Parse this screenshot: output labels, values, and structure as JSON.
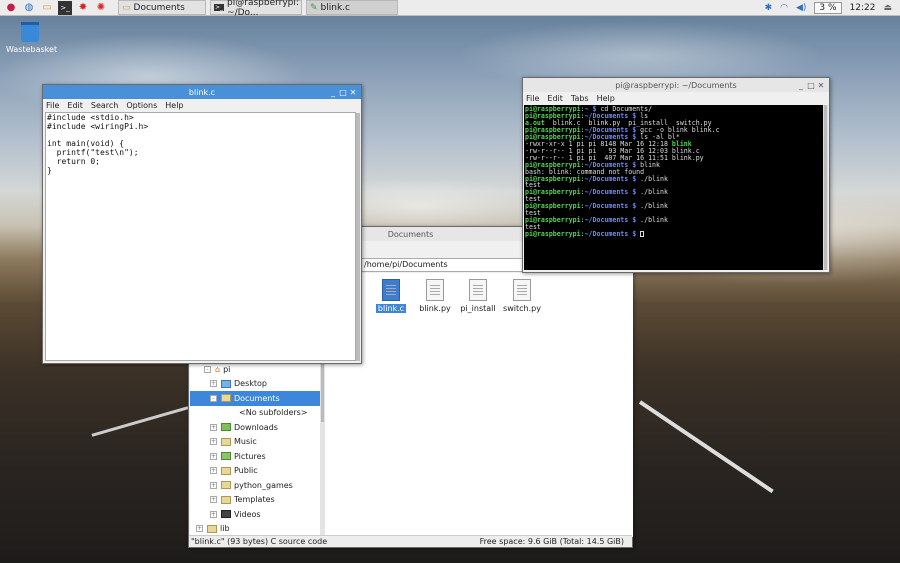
{
  "taskbar": {
    "launchers": [
      "raspberry-menu-icon",
      "web-browser-icon",
      "file-manager-icon",
      "terminal-icon",
      "math-icon",
      "wolfram-icon"
    ],
    "buttons": [
      {
        "label": "Documents",
        "icon": "folder-icon"
      },
      {
        "label": "pi@raspberrypi: ~/Do...",
        "icon": "terminal-icon"
      },
      {
        "label": "blink.c",
        "icon": "text-editor-icon"
      }
    ],
    "cpu": "3 %",
    "clock": "12:22"
  },
  "desktop": {
    "wastebasket_label": "Wastebasket"
  },
  "editor": {
    "title": "blink.c",
    "menu": [
      "File",
      "Edit",
      "Search",
      "Options",
      "Help"
    ],
    "content": "#include <stdio.h>\n#include <wiringPi.h>\n\nint main(void) {\n  printf(\"test\\n\");\n  return 0;\n}"
  },
  "file_manager": {
    "title": "Documents",
    "path": "/home/pi/Documents",
    "files": [
      {
        "name": "blink.c",
        "selected": true
      },
      {
        "name": "blink.py",
        "selected": false
      },
      {
        "name": "pi_install",
        "selected": false
      },
      {
        "name": "switch.py",
        "selected": false
      }
    ],
    "tree": [
      {
        "label": "pi",
        "indent": 1,
        "exp": "-",
        "selected": false
      },
      {
        "label": "Desktop",
        "indent": 2,
        "exp": "+",
        "selected": false
      },
      {
        "label": "Documents",
        "indent": 2,
        "exp": "-",
        "selected": true
      },
      {
        "label": "<No subfolders>",
        "indent": 3,
        "exp": "",
        "selected": false
      },
      {
        "label": "Downloads",
        "indent": 2,
        "exp": "+",
        "selected": false
      },
      {
        "label": "Music",
        "indent": 2,
        "exp": "+",
        "selected": false
      },
      {
        "label": "Pictures",
        "indent": 2,
        "exp": "+",
        "selected": false
      },
      {
        "label": "Public",
        "indent": 2,
        "exp": "+",
        "selected": false
      },
      {
        "label": "python_games",
        "indent": 2,
        "exp": "+",
        "selected": false
      },
      {
        "label": "Templates",
        "indent": 2,
        "exp": "+",
        "selected": false
      },
      {
        "label": "Videos",
        "indent": 2,
        "exp": "+",
        "selected": false
      },
      {
        "label": "lib",
        "indent": 1,
        "exp": "+",
        "selected": false
      }
    ],
    "status_left": "\"blink.c\" (93 bytes) C source code",
    "status_right": "Free space: 9.6 GiB (Total: 14.5 GiB)"
  },
  "terminal": {
    "title": "pi@raspberrypi: ~/Documents",
    "menu": [
      "File",
      "Edit",
      "Tabs",
      "Help"
    ],
    "lines": [
      [
        {
          "t": "pi@raspberrypi",
          "c": "g"
        },
        {
          "t": ":",
          "c": ""
        },
        {
          "t": "~ $",
          "c": "b"
        },
        {
          "t": " cd Documents/",
          "c": ""
        }
      ],
      [
        {
          "t": "pi@raspberrypi",
          "c": "g"
        },
        {
          "t": ":",
          "c": ""
        },
        {
          "t": "~/Documents $",
          "c": "b"
        },
        {
          "t": " ls",
          "c": ""
        }
      ],
      [
        {
          "t": "a.out",
          "c": "g"
        },
        {
          "t": "  blink.c  blink.py  pi_install  switch.py",
          "c": ""
        }
      ],
      [
        {
          "t": "pi@raspberrypi",
          "c": "g"
        },
        {
          "t": ":",
          "c": ""
        },
        {
          "t": "~/Documents $",
          "c": "b"
        },
        {
          "t": " gcc -o blink blink.c",
          "c": ""
        }
      ],
      [
        {
          "t": "pi@raspberrypi",
          "c": "g"
        },
        {
          "t": ":",
          "c": ""
        },
        {
          "t": "~/Documents $",
          "c": "b"
        },
        {
          "t": " ls -al bl*",
          "c": ""
        }
      ],
      [
        {
          "t": "-rwxr-xr-x 1 pi pi 8148 Mar 16 12:18 ",
          "c": ""
        },
        {
          "t": "blink",
          "c": "g"
        }
      ],
      [
        {
          "t": "-rw-r--r-- 1 pi pi   93 Mar 16 12:03 blink.c",
          "c": ""
        }
      ],
      [
        {
          "t": "-rw-r--r-- 1 pi pi  407 Mar 16 11:51 blink.py",
          "c": ""
        }
      ],
      [
        {
          "t": "pi@raspberrypi",
          "c": "g"
        },
        {
          "t": ":",
          "c": ""
        },
        {
          "t": "~/Documents $",
          "c": "b"
        },
        {
          "t": " blink",
          "c": ""
        }
      ],
      [
        {
          "t": "bash: blink: command not found",
          "c": ""
        }
      ],
      [
        {
          "t": "pi@raspberrypi",
          "c": "g"
        },
        {
          "t": ":",
          "c": ""
        },
        {
          "t": "~/Documents $",
          "c": "b"
        },
        {
          "t": " ./blink",
          "c": ""
        }
      ],
      [
        {
          "t": "test",
          "c": ""
        }
      ],
      [
        {
          "t": "pi@raspberrypi",
          "c": "g"
        },
        {
          "t": ":",
          "c": ""
        },
        {
          "t": "~/Documents $",
          "c": "b"
        },
        {
          "t": " ./blink",
          "c": ""
        }
      ],
      [
        {
          "t": "test",
          "c": ""
        }
      ],
      [
        {
          "t": "pi@raspberrypi",
          "c": "g"
        },
        {
          "t": ":",
          "c": ""
        },
        {
          "t": "~/Documents $",
          "c": "b"
        },
        {
          "t": " ./blink",
          "c": ""
        }
      ],
      [
        {
          "t": "test",
          "c": ""
        }
      ],
      [
        {
          "t": "pi@raspberrypi",
          "c": "g"
        },
        {
          "t": ":",
          "c": ""
        },
        {
          "t": "~/Documents $",
          "c": "b"
        },
        {
          "t": " ./blink",
          "c": ""
        }
      ],
      [
        {
          "t": "test",
          "c": ""
        }
      ],
      [
        {
          "t": "pi@raspberrypi",
          "c": "g"
        },
        {
          "t": ":",
          "c": ""
        },
        {
          "t": "~/Documents $",
          "c": "b"
        },
        {
          "t": " ",
          "c": ""
        }
      ]
    ]
  }
}
